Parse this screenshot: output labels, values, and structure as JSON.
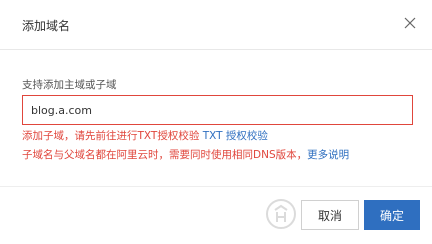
{
  "dialog": {
    "title": "添加域名",
    "close_icon": "close-icon"
  },
  "form": {
    "label": "支持添加主域或子域",
    "input_value": "blog.a.com",
    "error_line1_text": "添加子域，请先前往进行TXT授权校验",
    "error_line1_link": "TXT 授权校验",
    "error_line2_text": "子域名与父域名都在阿里云时，需要同时使用相同DNS版本，",
    "error_line2_link": "更多说明"
  },
  "footer": {
    "cancel_label": "取消",
    "ok_label": "确定"
  },
  "colors": {
    "error": "#e0463c",
    "link": "#2f6fc0",
    "primary": "#2f6fc0"
  }
}
